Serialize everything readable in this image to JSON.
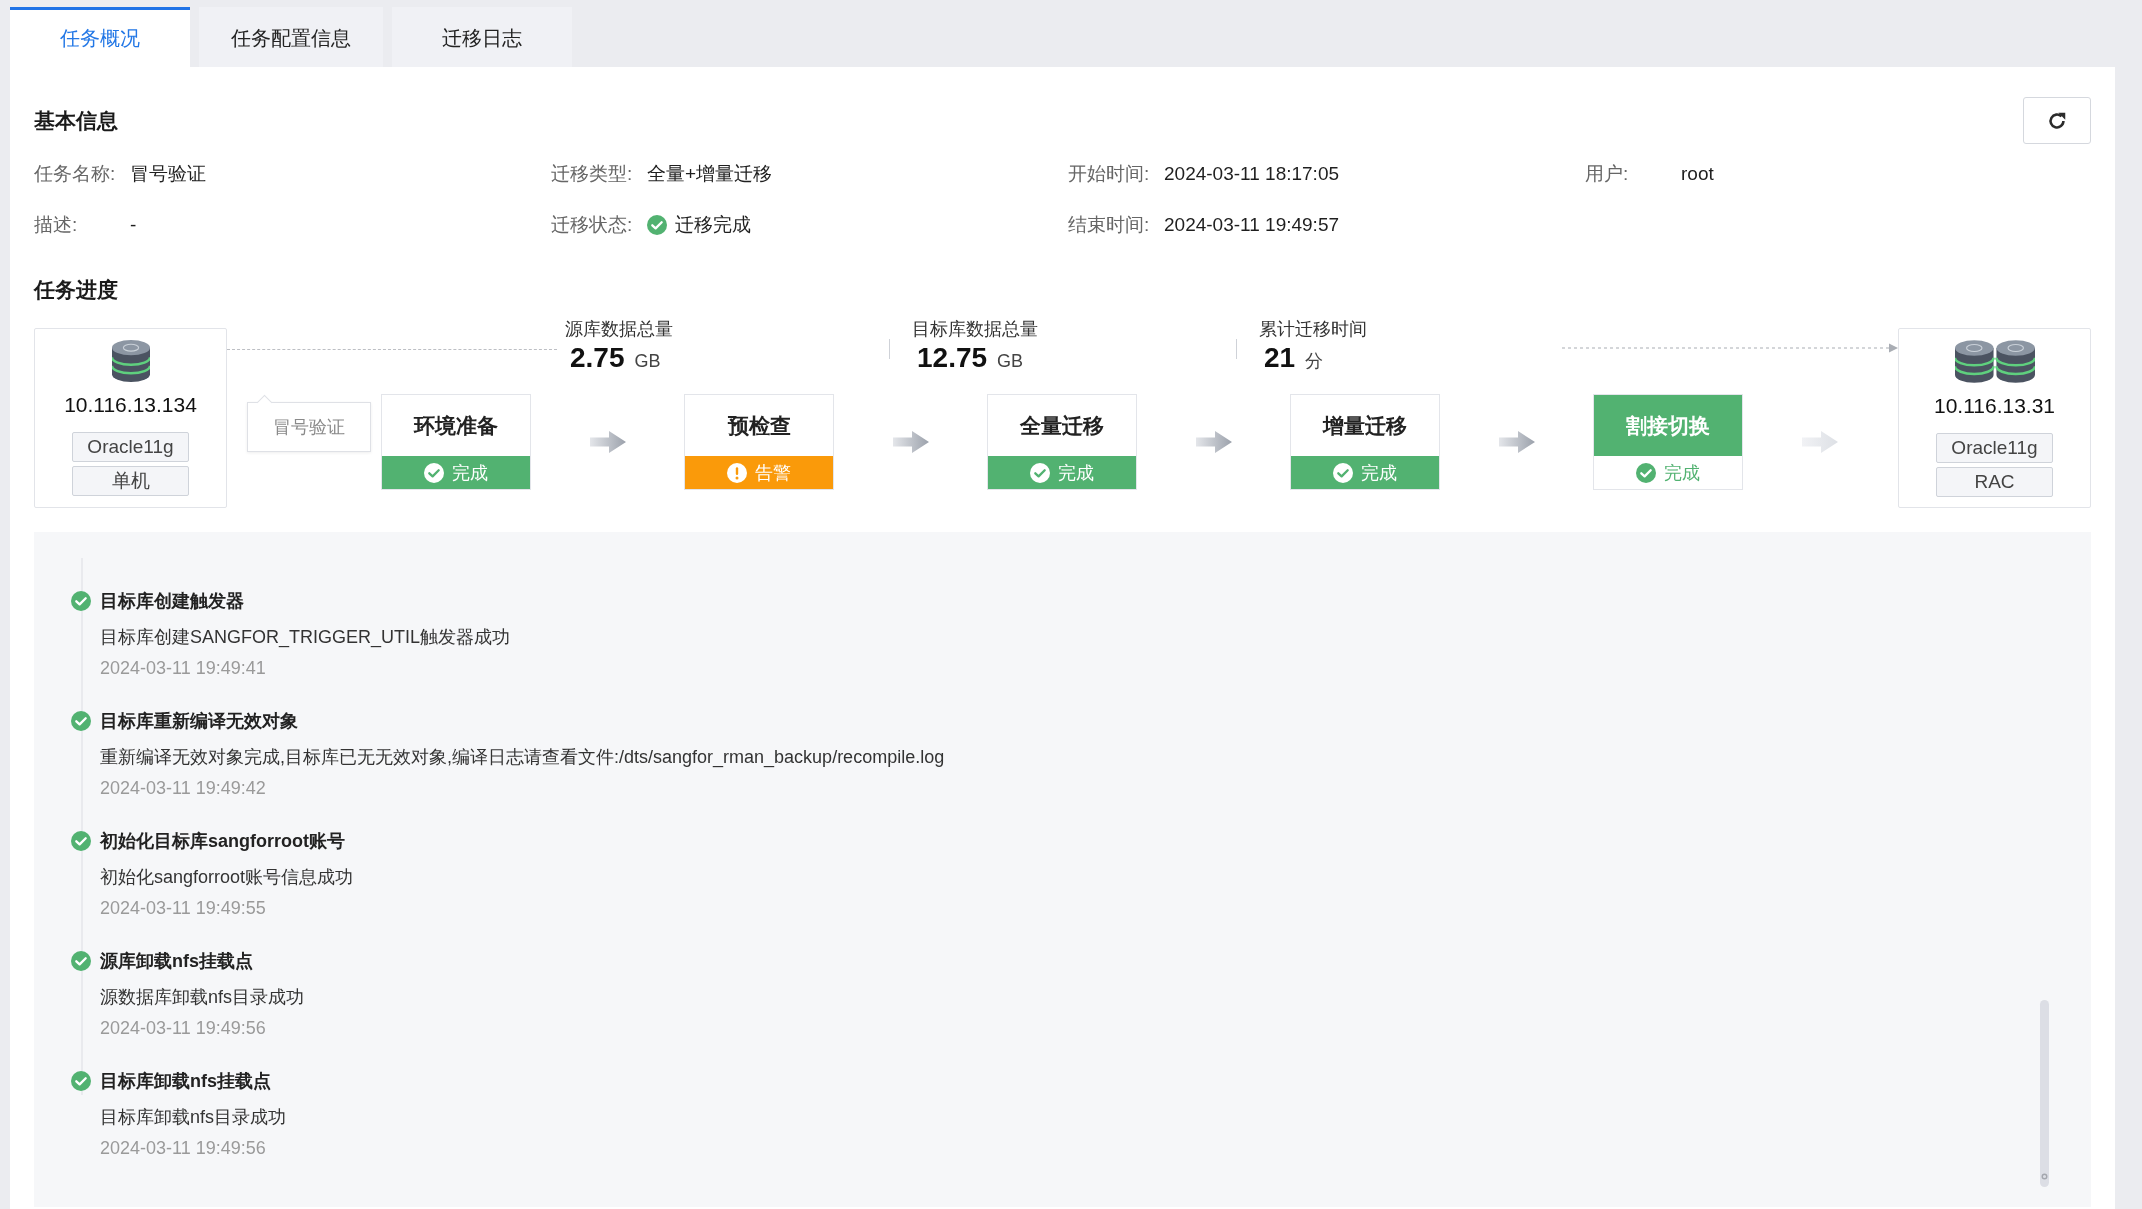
{
  "tabs": [
    {
      "label": "任务概况",
      "selected": true
    },
    {
      "label": "任务配置信息",
      "selected": false
    },
    {
      "label": "迁移日志",
      "selected": false
    }
  ],
  "basic_info": {
    "title": "基本信息",
    "fields": [
      {
        "kind": "text",
        "name": "任务名称:",
        "value": "冒号验证"
      },
      {
        "kind": "text",
        "name": "迁移类型:",
        "value": "全量+增量迁移"
      },
      {
        "kind": "text",
        "name": "开始时间:",
        "value": "2024-03-11 18:17:05"
      },
      {
        "kind": "text",
        "name": "用户:",
        "value": "root"
      },
      {
        "kind": "text",
        "name": "描述:",
        "value": "-"
      },
      {
        "kind": "status",
        "name": "迁移状态:",
        "value": "迁移完成",
        "success": true
      },
      {
        "kind": "text",
        "name": "结束时间:",
        "value": "2024-03-11 19:49:57"
      }
    ]
  },
  "progress": {
    "title": "任务进度",
    "source": {
      "kind": "single",
      "ip": "10.116.13.134",
      "db_type": "Oracle11g",
      "mode": "单机"
    },
    "stats": [
      {
        "label": "源库数据总量",
        "value": "2.75",
        "unit": "GB"
      },
      {
        "label": "目标库数据总量",
        "value": "12.75",
        "unit": "GB"
      },
      {
        "label": "累计迁移时间",
        "value": "21",
        "unit": "分"
      }
    ],
    "task_name": "冒号验证",
    "stages": [
      {
        "name": "环境准备",
        "status_text": "完成",
        "warning": false,
        "current": false
      },
      {
        "name": "预检查",
        "status_text": "告警",
        "warning": true,
        "current": false
      },
      {
        "name": "全量迁移",
        "status_text": "完成",
        "warning": false,
        "current": false
      },
      {
        "name": "增量迁移",
        "status_text": "完成",
        "warning": false,
        "current": false
      },
      {
        "name": "割接切换",
        "status_text": "完成",
        "warning": false,
        "current": true
      }
    ],
    "target": {
      "kind": "cluster",
      "ip": "10.116.13.31",
      "db_type": "Oracle11g",
      "mode": "RAC"
    }
  },
  "log": [
    {
      "title": "目标库创建触发器",
      "detail": "目标库创建SANGFOR_TRIGGER_UTIL触发器成功",
      "time": "2024-03-11 19:49:41",
      "success": true
    },
    {
      "title": "目标库重新编译无效对象",
      "detail": "重新编译无效对象完成,目标库已无无效对象,编译日志请查看文件:/dts/sangfor_rman_backup/recompile.log",
      "time": "2024-03-11 19:49:42",
      "success": true
    },
    {
      "title": "初始化目标库sangforroot账号",
      "detail": "初始化sangforroot账号信息成功",
      "time": "2024-03-11 19:49:55",
      "success": true
    },
    {
      "title": "源库卸载nfs挂载点",
      "detail": "源数据库卸载nfs目录成功",
      "time": "2024-03-11 19:49:56",
      "success": true
    },
    {
      "title": "目标库卸载nfs挂载点",
      "detail": "目标库卸载nfs目录成功",
      "time": "2024-03-11 19:49:56",
      "success": true
    }
  ]
}
